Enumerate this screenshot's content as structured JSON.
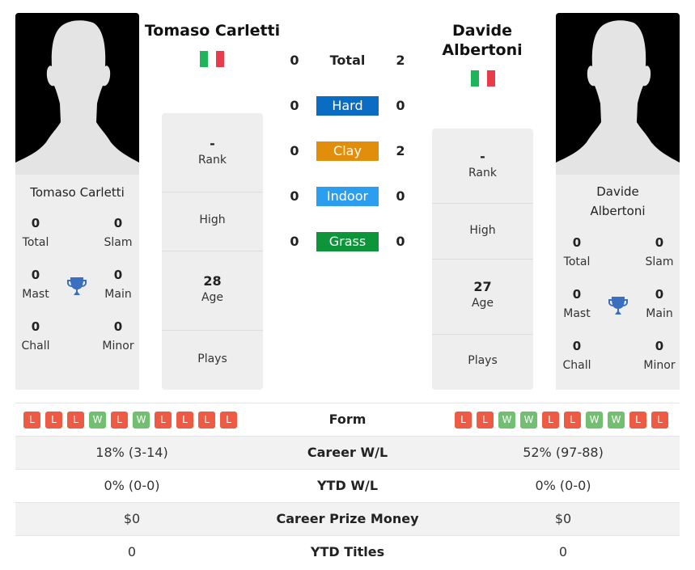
{
  "player1": {
    "name": "Tomaso Carletti",
    "country": "Italy",
    "flag_colors": [
      "#1eb45a",
      "#ffffff",
      "#e83c4c"
    ],
    "titles": {
      "total": {
        "value": "0",
        "label": "Total"
      },
      "slam": {
        "value": "0",
        "label": "Slam"
      },
      "mast": {
        "value": "0",
        "label": "Mast"
      },
      "main": {
        "value": "0",
        "label": "Main"
      },
      "chall": {
        "value": "0",
        "label": "Chall"
      },
      "minor": {
        "value": "0",
        "label": "Minor"
      }
    },
    "rank": {
      "value": "-",
      "label": "Rank"
    },
    "high": {
      "value": "",
      "label": "High"
    },
    "age": {
      "value": "28",
      "label": "Age"
    },
    "plays": {
      "value": "",
      "label": "Plays"
    },
    "form": [
      "L",
      "L",
      "L",
      "W",
      "L",
      "W",
      "L",
      "L",
      "L",
      "L"
    ],
    "career_wl": "18% (3-14)",
    "ytd_wl": "0% (0-0)",
    "prize_money": "$0",
    "ytd_titles": "0"
  },
  "player2": {
    "name": "Davide Albertoni",
    "name_line1": "Davide",
    "name_line2": "Albertoni",
    "country": "Italy",
    "flag_colors": [
      "#1eb45a",
      "#ffffff",
      "#e83c4c"
    ],
    "titles": {
      "total": {
        "value": "0",
        "label": "Total"
      },
      "slam": {
        "value": "0",
        "label": "Slam"
      },
      "mast": {
        "value": "0",
        "label": "Mast"
      },
      "main": {
        "value": "0",
        "label": "Main"
      },
      "chall": {
        "value": "0",
        "label": "Chall"
      },
      "minor": {
        "value": "0",
        "label": "Minor"
      }
    },
    "rank": {
      "value": "-",
      "label": "Rank"
    },
    "high": {
      "value": "",
      "label": "High"
    },
    "age": {
      "value": "27",
      "label": "Age"
    },
    "plays": {
      "value": "",
      "label": "Plays"
    },
    "form": [
      "L",
      "L",
      "W",
      "W",
      "L",
      "L",
      "W",
      "W",
      "L",
      "L"
    ],
    "career_wl": "52% (97-88)",
    "ytd_wl": "0% (0-0)",
    "prize_money": "$0",
    "ytd_titles": "0"
  },
  "h2h": [
    {
      "label": "Total",
      "p1": "0",
      "p2": "2",
      "color": ""
    },
    {
      "label": "Hard",
      "p1": "0",
      "p2": "0",
      "color": "#0a6cc2"
    },
    {
      "label": "Clay",
      "p1": "0",
      "p2": "2",
      "color": "#e08e0b"
    },
    {
      "label": "Indoor",
      "p1": "0",
      "p2": "0",
      "color": "#2c9ef0"
    },
    {
      "label": "Grass",
      "p1": "0",
      "p2": "0",
      "color": "#0e9439"
    }
  ],
  "comparison": {
    "form_label": "Form",
    "career_wl_label": "Career W/L",
    "ytd_wl_label": "YTD W/L",
    "prize_money_label": "Career Prize Money",
    "ytd_titles_label": "YTD Titles"
  },
  "colors": {
    "loss": "#ee5a44",
    "win": "#72bf72",
    "trophy": "#3a6fbf"
  }
}
